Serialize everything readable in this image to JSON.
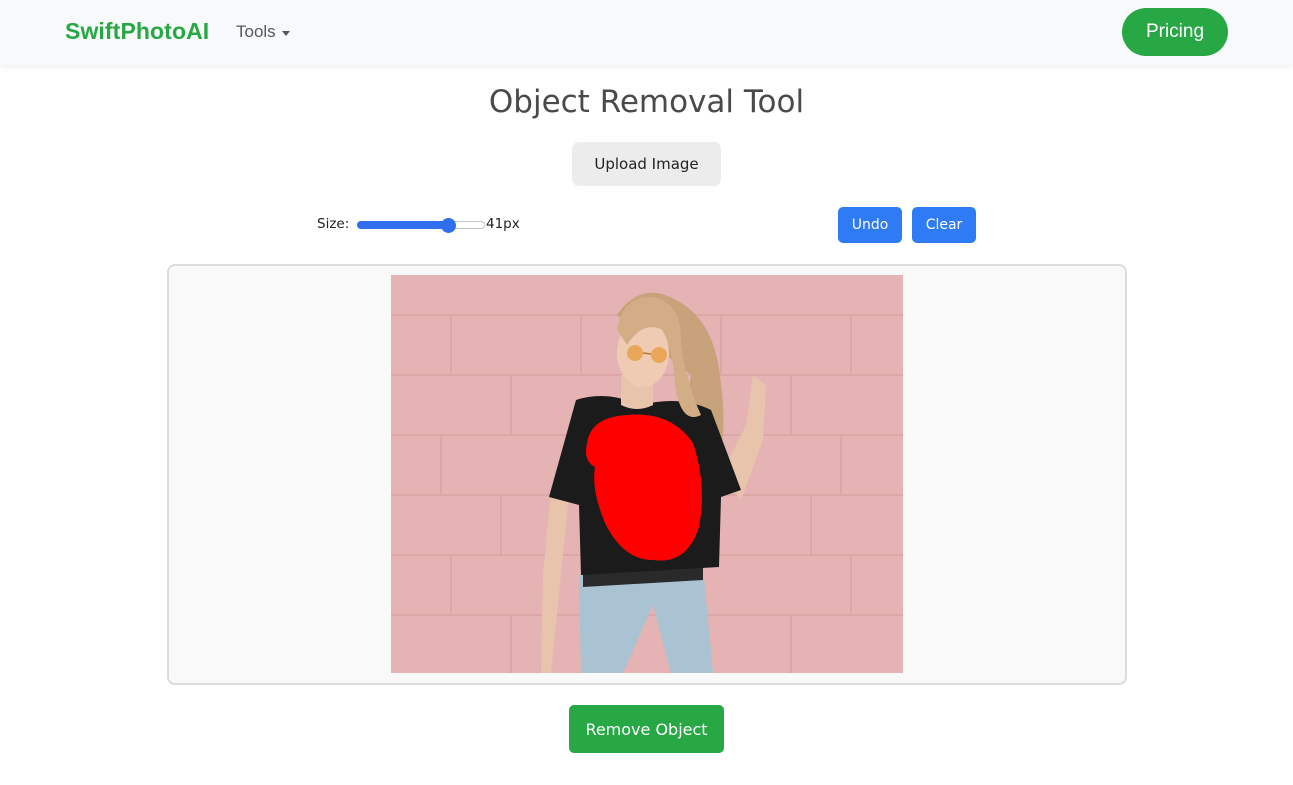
{
  "navbar": {
    "brand": "SwiftPhotoAI",
    "tools_label": "Tools",
    "pricing_label": "Pricing"
  },
  "page": {
    "title": "Object Removal Tool",
    "upload_label": "Upload Image"
  },
  "brush": {
    "size_label": "Size:",
    "size_value_text": "41px",
    "size_value": 41,
    "size_min": 1,
    "size_max": 55
  },
  "actions": {
    "undo_label": "Undo",
    "clear_label": "Clear",
    "remove_label": "Remove Object"
  },
  "colors": {
    "brand_green": "#28a745",
    "action_blue": "#2f7bf5",
    "mask_red": "#ff0000",
    "wall_pink": "#e5b3b3"
  },
  "image": {
    "subject": "photo-woman-pink-wall",
    "mask": "red-brush-mask"
  }
}
